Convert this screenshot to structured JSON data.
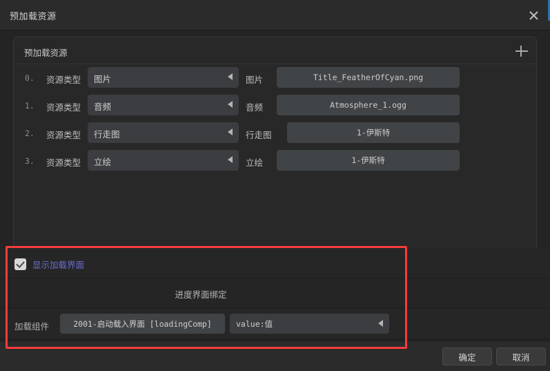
{
  "window": {
    "title": "预加载资源",
    "close_icon": "close-icon"
  },
  "panel": {
    "title": "预加载资源",
    "add_icon": "plus-icon",
    "rows": [
      {
        "index": "0.",
        "type_label": "资源类型",
        "type_value": "图片",
        "asset_label": "图片",
        "asset_value": "Title_FeatherOfCyan.png"
      },
      {
        "index": "1.",
        "type_label": "资源类型",
        "type_value": "音频",
        "asset_label": "音频",
        "asset_value": "Atmosphere_1.ogg"
      },
      {
        "index": "2.",
        "type_label": "资源类型",
        "type_value": "行走图",
        "asset_label": "行走图",
        "asset_value": "1-伊斯特"
      },
      {
        "index": "3.",
        "type_label": "资源类型",
        "type_value": "立绘",
        "asset_label": "立绘",
        "asset_value": "1-伊斯特"
      }
    ]
  },
  "settings": {
    "show_loading_label": "显示加载界面",
    "show_loading_checked": true,
    "bind_section_title": "进度界面绑定",
    "component_label": "加载组件",
    "component_value": "2001-启动载入界面 [loadingComp]",
    "property_value": "value:值"
  },
  "footer": {
    "confirm_label": "确定",
    "cancel_label": "取消"
  },
  "colors": {
    "highlight": "#f73c3c",
    "checkbox_label": "#6c6cd0",
    "accent_edge": "#2f6fb0"
  }
}
